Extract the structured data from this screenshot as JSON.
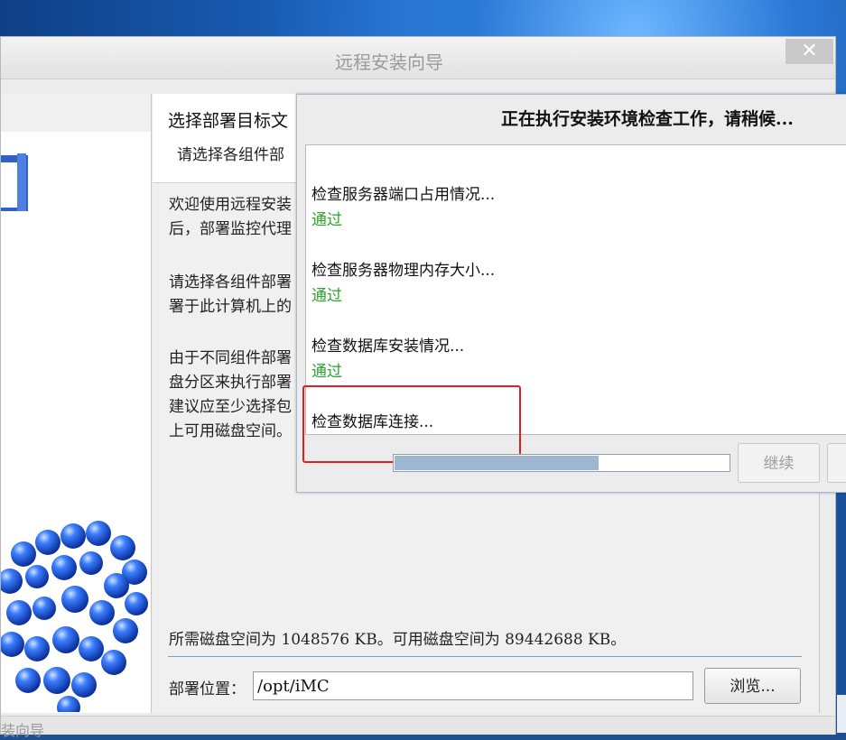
{
  "wizard": {
    "title": "远程安装向导",
    "close_glyph": "✕",
    "page_title": "选择部署目标文",
    "page_subtitle": "请选择各组件部",
    "paragraphs": [
      [
        "欢迎使用远程安装",
        "后，部署监控代理"
      ],
      [
        "请选择各组件部署",
        "署于此计算机上的"
      ],
      [
        "由于不同组件部署",
        "盘分区来执行部署",
        "建议应至少选择包",
        "上可用磁盘空间。"
      ]
    ],
    "disk_info": "所需磁盘空间为 1048576 KB。可用磁盘空间为 89442688 KB。",
    "deploy_label": "部署位置：",
    "deploy_value": "/opt/iMC",
    "browse_label": "浏览...",
    "bottom_text": "装向导"
  },
  "dialog": {
    "title": "正在执行安装环境检查工作，请稍候...",
    "log": [
      {
        "text": "检查服务器端口占用情况...",
        "status": "通过"
      },
      {
        "text": "检查服务器物理内存大小...",
        "status": "通过"
      },
      {
        "text": "检查数据库安装情况...",
        "status": "通过"
      },
      {
        "text": "检查数据库连接...",
        "status": ""
      }
    ],
    "progress": 0.61,
    "continue_label": "继续"
  },
  "colors": {
    "ok_green": "#2aa52a",
    "highlight_red": "#e02020",
    "progress_fill": "#9db6d2"
  },
  "icons": {
    "close": "close-icon",
    "book": "book-icon",
    "molecule": "molecule-graphic"
  }
}
